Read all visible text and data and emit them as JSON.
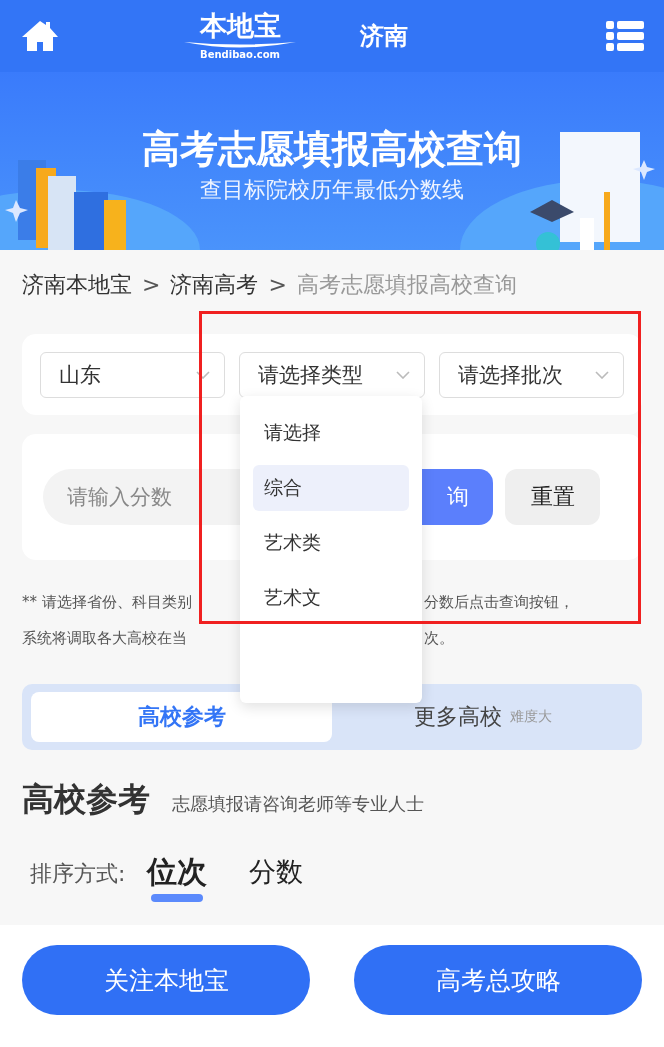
{
  "header": {
    "logo_text": "本地宝",
    "logo_domain": "Bendibao.com",
    "city": "济南"
  },
  "banner": {
    "kind": "picture",
    "title": "高考志愿填报高校查询",
    "subtitle": "查目标院校历年最低分数线"
  },
  "breadcrumb": {
    "items": [
      {
        "label": "济南本地宝",
        "current": false
      },
      {
        "label": "济南高考",
        "current": false
      },
      {
        "label": "高考志愿填报高校查询",
        "current": true
      }
    ],
    "separators": [
      ">",
      ">"
    ]
  },
  "filters": [
    {
      "label": "山东"
    },
    {
      "label": "请选择类型"
    },
    {
      "label": "请选择批次"
    }
  ],
  "dropdown": {
    "options": [
      {
        "label": "请选择",
        "selected": false
      },
      {
        "label": "综合",
        "selected": true
      },
      {
        "label": "艺术类",
        "selected": false
      },
      {
        "label": "艺术文",
        "selected": false
      }
    ]
  },
  "score": {
    "placeholder": "请输入分数",
    "query_button": "询",
    "reset_button": "重置"
  },
  "note": {
    "lines": [
      {
        "left": "** 请选择省份、科目类别",
        "right": "分数后点击查询按钮，"
      },
      {
        "left": "系统将调取各大高校在当",
        "right": "次。"
      }
    ]
  },
  "tabs": [
    {
      "label": "高校参考",
      "selected": true
    },
    {
      "label": "更多高校",
      "note": "难度大",
      "selected": false
    }
  ],
  "section": {
    "title": "高校参考",
    "subtitle": "志愿填报请咨询老师等专业人士"
  },
  "sort": {
    "label": "排序方式:",
    "options": [
      {
        "label": "位次",
        "selected": true
      },
      {
        "label": "分数",
        "selected": false
      }
    ]
  },
  "footer_buttons": [
    "关注本地宝",
    "高考总攻略"
  ]
}
